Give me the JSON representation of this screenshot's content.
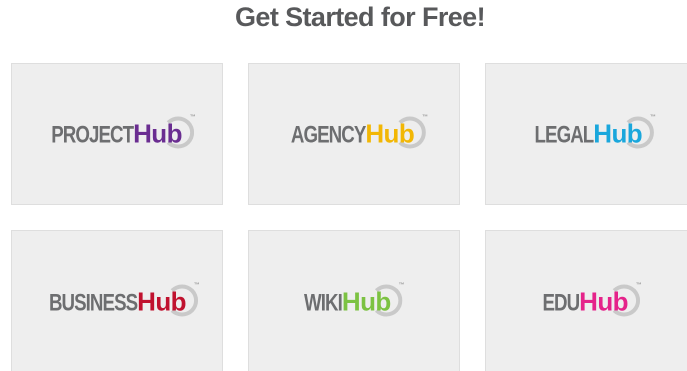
{
  "heading": "Get Started for Free!",
  "products": [
    {
      "prefix": "PROJECT",
      "suffix": "Hub",
      "accent": "#6a2d91"
    },
    {
      "prefix": "AGENCY",
      "suffix": "Hub",
      "accent": "#f2b705"
    },
    {
      "prefix": "LEGAL",
      "suffix": "Hub",
      "accent": "#1aa7dc"
    },
    {
      "prefix": "BUSINESS",
      "suffix": "Hub",
      "accent": "#c0122f"
    },
    {
      "prefix": "WIKI",
      "suffix": "Hub",
      "accent": "#7cc242"
    },
    {
      "prefix": "EDU",
      "suffix": "Hub",
      "accent": "#e5238a"
    }
  ],
  "trademark": "™"
}
